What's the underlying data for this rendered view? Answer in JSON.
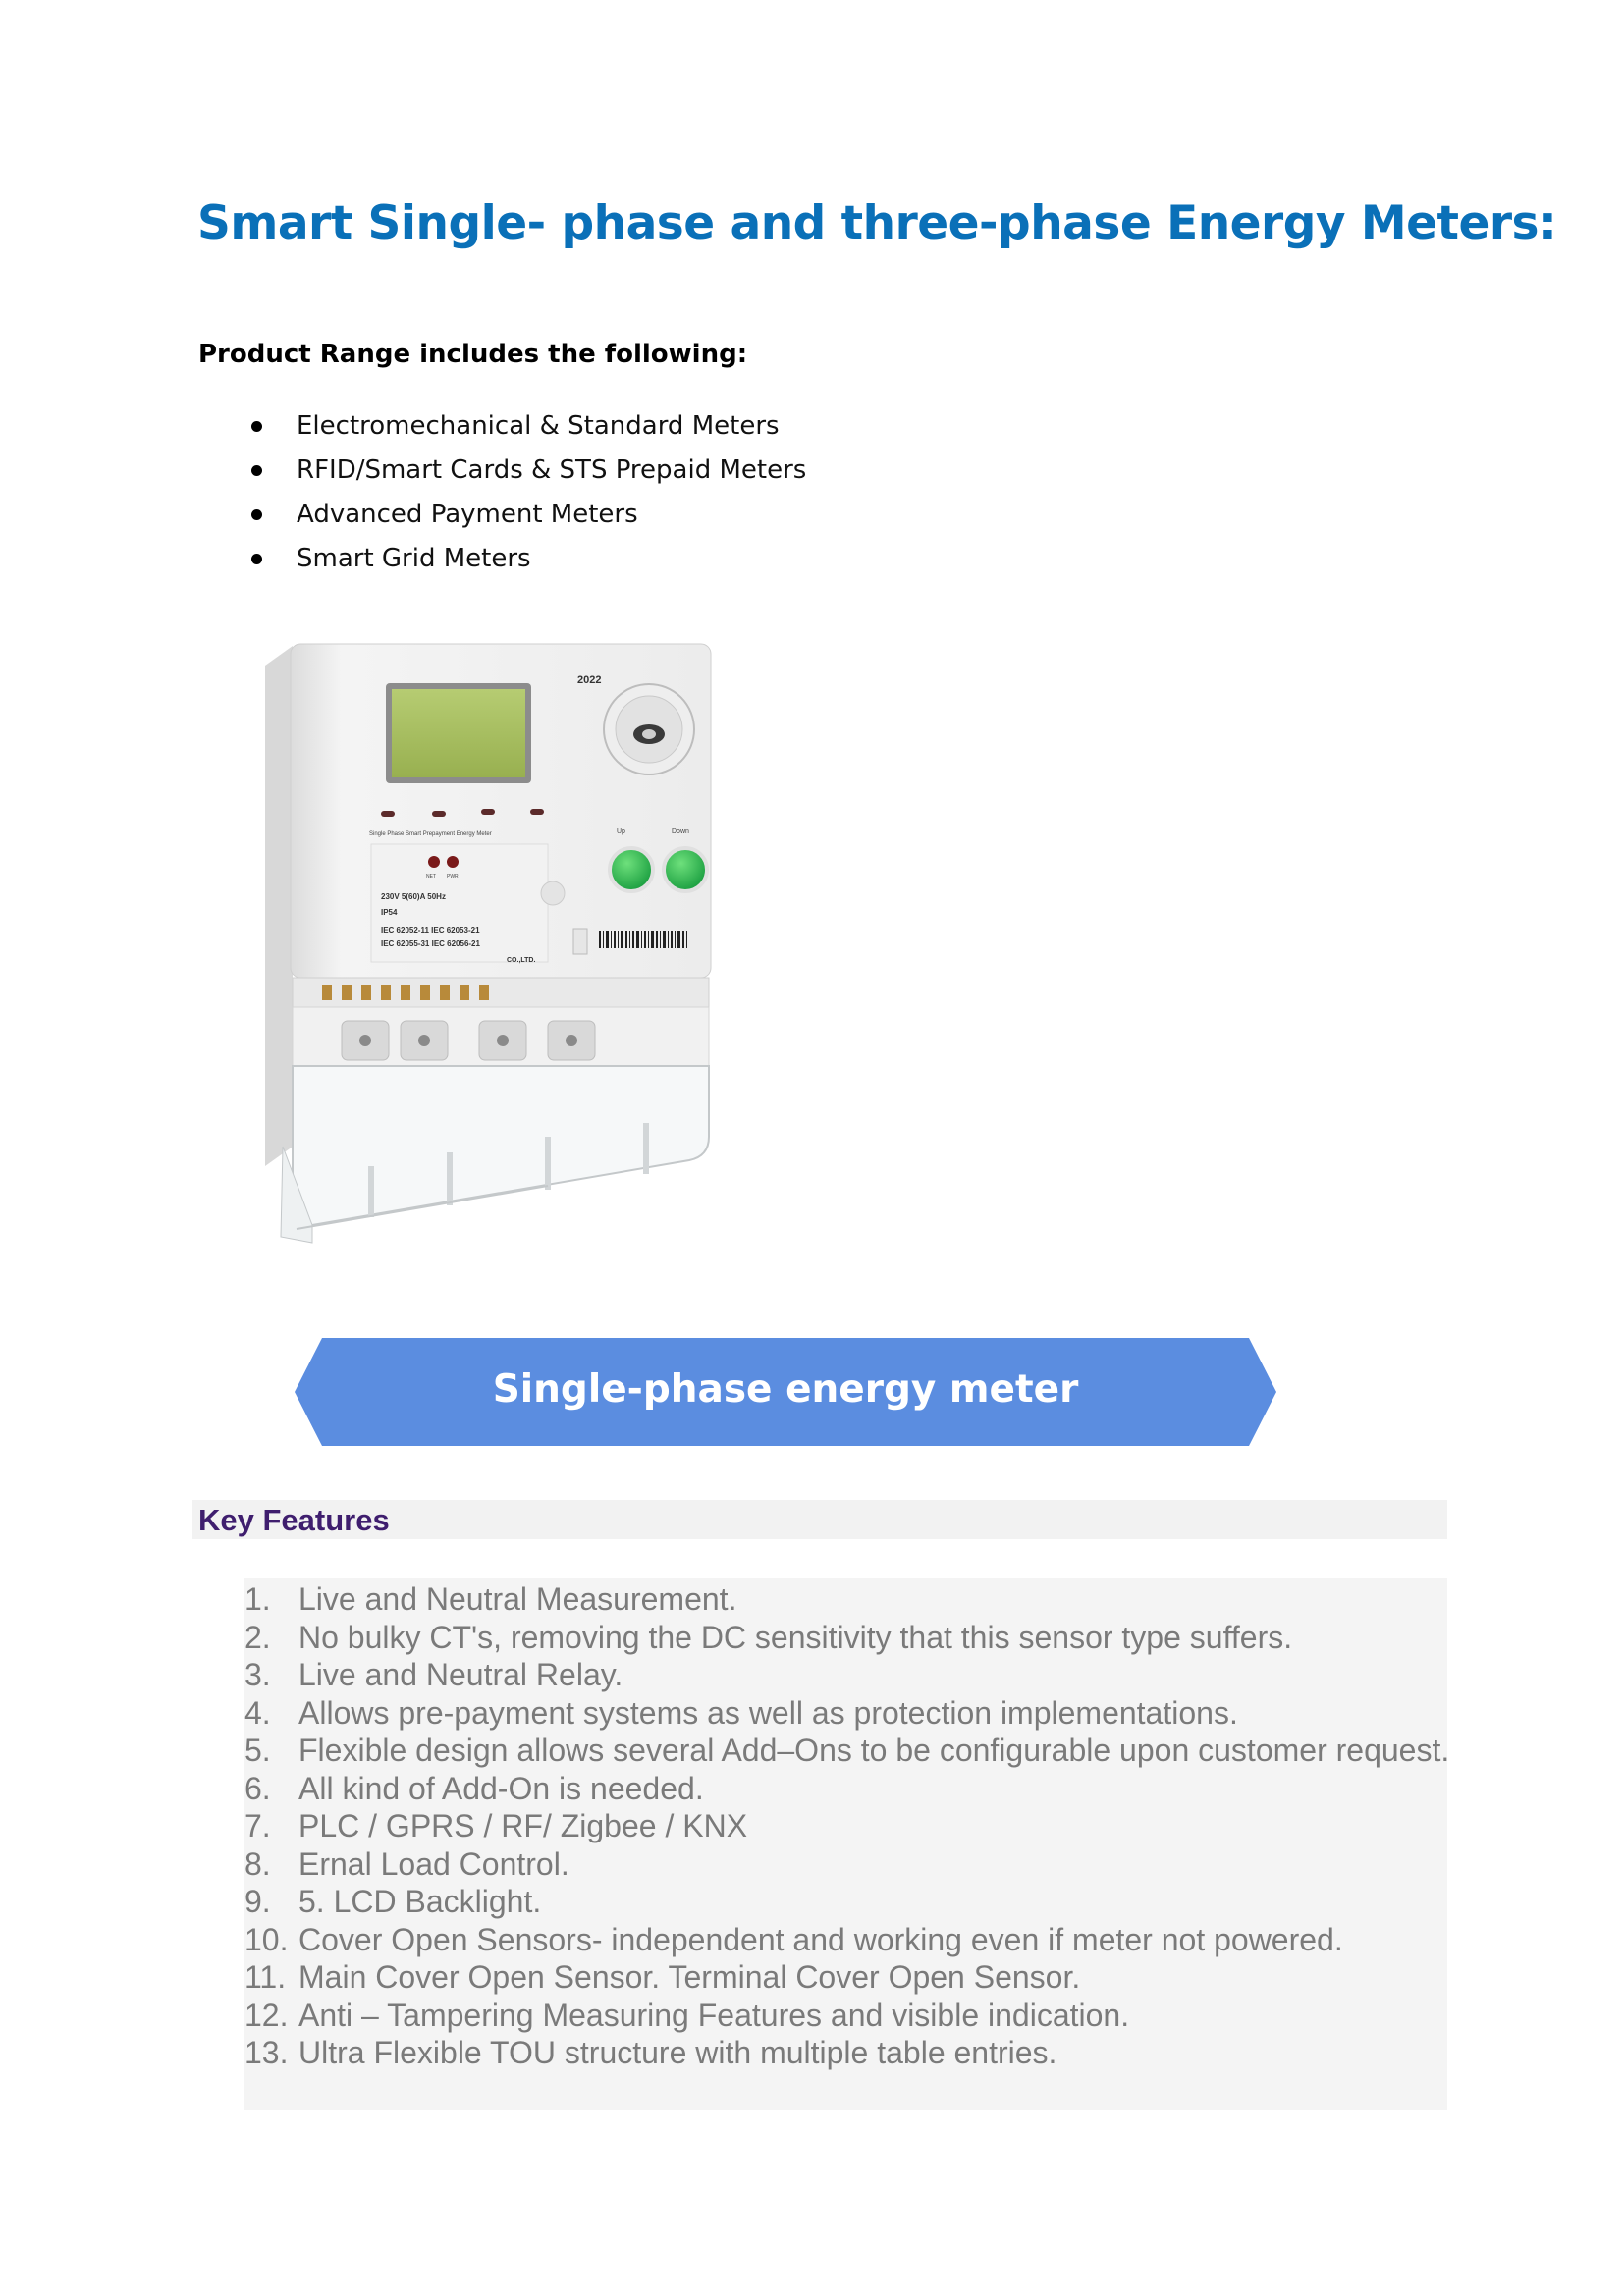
{
  "title": "Smart Single- phase and three-phase Energy Meters:",
  "product_range": {
    "heading": "Product Range includes the following:",
    "items": [
      "Electromechanical & Standard Meters",
      "RFID/Smart Cards & STS Prepaid Meters",
      "Advanced Payment Meters",
      "Smart Grid Meters"
    ]
  },
  "meter_image": {
    "year": "2022",
    "label_lines": [
      "230V  5(60)A  50Hz",
      "IP54",
      "IEC 62052-11  IEC 62053-21",
      "IEC 62055-31  IEC 62056-21"
    ],
    "company_suffix": "CO.,LTD.",
    "button_labels": [
      "Up",
      "Down"
    ],
    "subtitle": "Single Phase Smart Prepayment Energy Meter",
    "indicators": [
      "NET",
      "PWR"
    ],
    "colors": {
      "lcd": "#a8c060",
      "buttons": "#22b14c",
      "body": "#f0f0f0"
    }
  },
  "banner": {
    "label": "Single-phase energy meter",
    "color": "#5b8de0"
  },
  "key_features": {
    "heading": "Key Features",
    "items": [
      {
        "num": "1.",
        "text": "Live and Neutral Measurement."
      },
      {
        "num": "2.",
        "text": "No bulky CT's, removing the DC sensitivity that this sensor type suffers."
      },
      {
        "num": "3.",
        "text": "Live and Neutral Relay."
      },
      {
        "num": "4.",
        "text": "Allows pre-payment systems as well as protection implementations."
      },
      {
        "num": "5.",
        "text": "Flexible design allows several Add–Ons to be configurable upon customer request."
      },
      {
        "num": "6.",
        "text": "All kind of Add-On is needed."
      },
      {
        "num": "7.",
        "text": "PLC / GPRS / RF/ Zigbee / KNX"
      },
      {
        "num": "8.",
        "text": "Ernal Load Control."
      },
      {
        "num": "9.",
        "text": "5. LCD Backlight."
      },
      {
        "num": "10.",
        "text": "Cover Open Sensors- independent and working even if meter not powered."
      },
      {
        "num": "11.",
        "text": "Main Cover Open Sensor. Terminal Cover Open Sensor."
      },
      {
        "num": "12.",
        "text": "Anti – Tampering Measuring Features and visible indication."
      },
      {
        "num": "13.",
        "text": "Ultra Flexible TOU structure with multiple table entries."
      }
    ]
  }
}
